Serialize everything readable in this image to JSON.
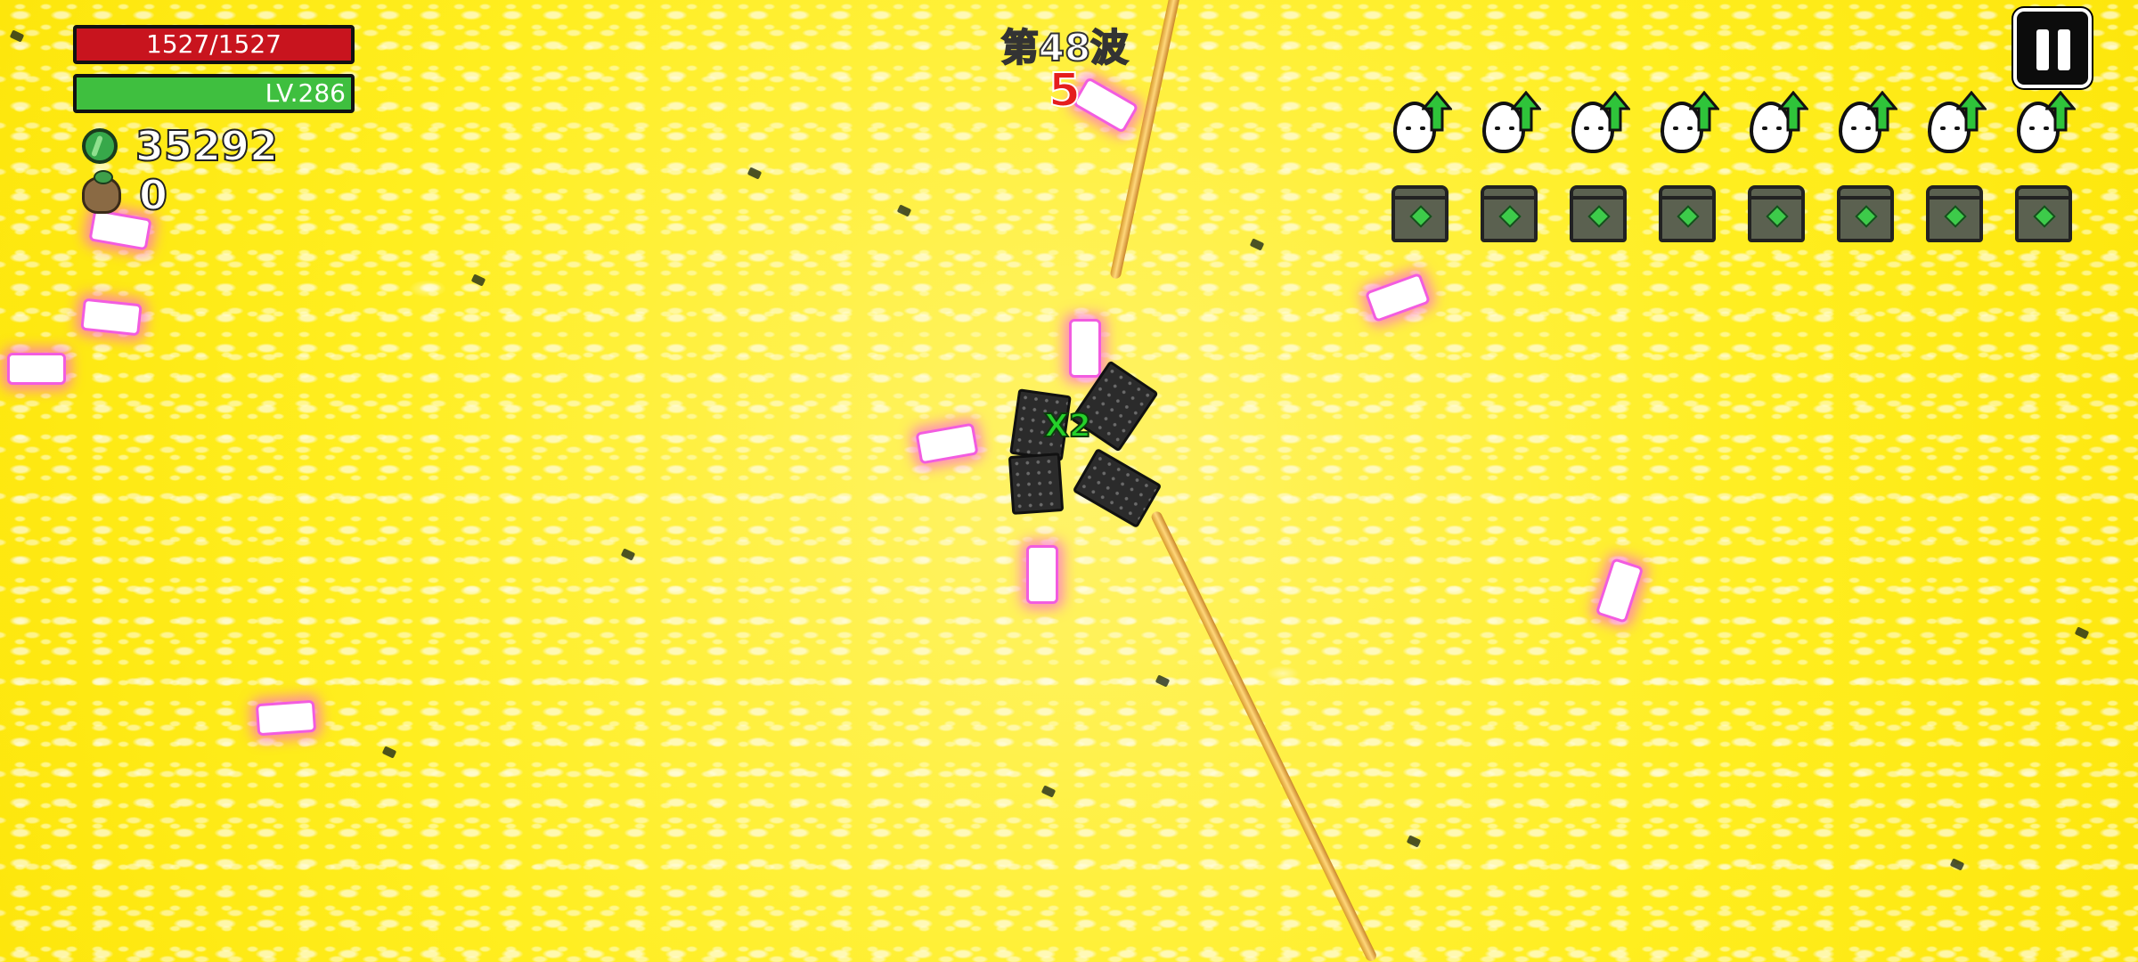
{
  "hud": {
    "hp_text": "1527/1527",
    "level_text": "LV.286",
    "coins": "35292",
    "bag_count": "0",
    "hp_fraction": 1.0,
    "colors": {
      "hp": "#c8141e",
      "level": "#3fbf3f"
    }
  },
  "wave": {
    "title": "第48波",
    "countdown": "5"
  },
  "combat": {
    "combo_text": "X2"
  },
  "skills": {
    "egg_upgrade_count": 8,
    "crate_count": 8,
    "icons": [
      "egg-upgrade-icon",
      "supply-crate-icon"
    ]
  },
  "icons": {
    "coin": "coin-icon",
    "bag": "money-bag-icon",
    "pause": "pause-icon"
  }
}
